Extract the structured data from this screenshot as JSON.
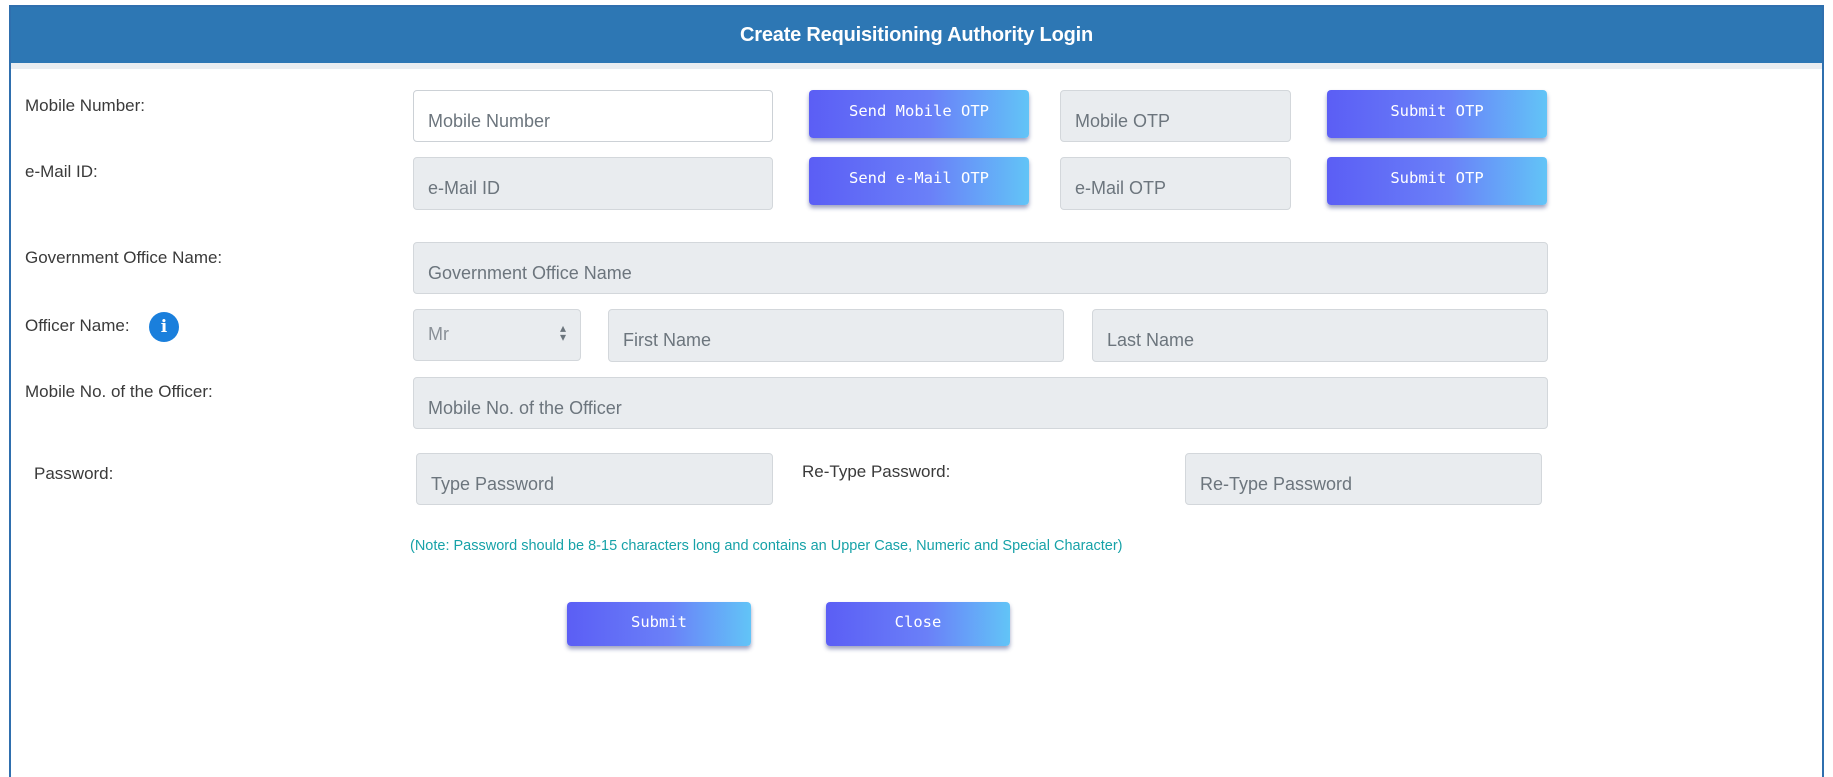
{
  "header": {
    "title": "Create Requisitioning Authority Login"
  },
  "labels": {
    "mobile_number": "Mobile Number:",
    "email_id": "e-Mail ID:",
    "office_name": "Government Office Name:",
    "officer_name": "Officer Name:",
    "officer_mobile": "Mobile No. of the Officer:",
    "password": "Password:",
    "retype_password": "Re-Type Password:"
  },
  "placeholders": {
    "mobile_number": "Mobile Number",
    "mobile_otp": "Mobile OTP",
    "email_id": "e-Mail ID",
    "email_otp": "e-Mail OTP",
    "office_name": "Government Office Name",
    "first_name": "First Name",
    "last_name": "Last Name",
    "officer_mobile": "Mobile No. of the Officer",
    "password": "Type Password",
    "retype_password": "Re-Type Password"
  },
  "title_select": {
    "value": "Mr"
  },
  "buttons": {
    "send_mobile_otp": "Send Mobile OTP",
    "submit_mobile_otp": "Submit OTP",
    "send_email_otp": "Send e-Mail OTP",
    "submit_email_otp": "Submit OTP",
    "submit": "Submit",
    "close": "Close"
  },
  "info_icon": {
    "glyph": "i",
    "icon": "info-icon"
  },
  "note": "(Note: Password should be 8-15 characters long and contains an Upper Case, Numeric and Special Character)",
  "colors": {
    "header_bg": "#2d77b4",
    "button_gradient_start": "#5b5ef5",
    "button_gradient_end": "#62c4f7",
    "note_text": "#17a2a8",
    "disabled_field_bg": "#e9ecef"
  }
}
